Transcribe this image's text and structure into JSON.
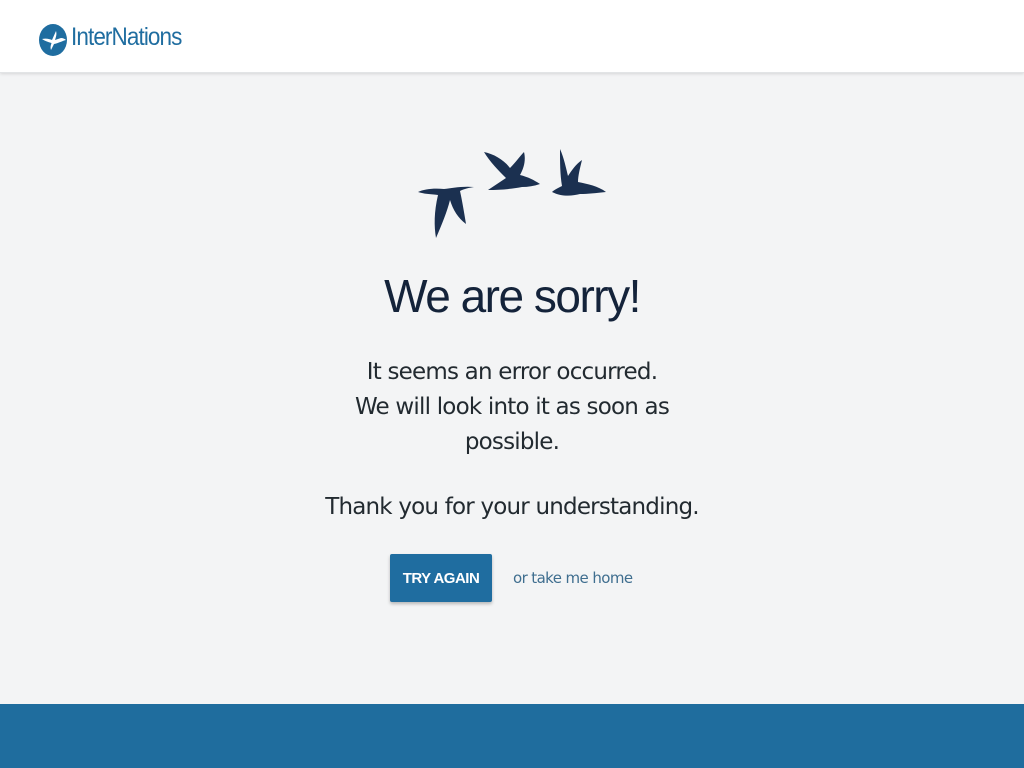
{
  "header": {
    "logo_text": "InterNations",
    "logo_icon": "bird-icon",
    "brand_color": "#1f6da0"
  },
  "illustration": {
    "icon": "flying-birds-icon",
    "color": "#1b3050"
  },
  "error": {
    "title": "We are sorry!",
    "message_lines": [
      "It seems an error occurred.",
      "We will look into it as soon as",
      "possible."
    ],
    "thanks": "Thank you for your understanding."
  },
  "actions": {
    "try_again_label": "TRY AGAIN",
    "home_link_label": "or take me home"
  },
  "footer": {
    "color": "#1f6d9e"
  }
}
